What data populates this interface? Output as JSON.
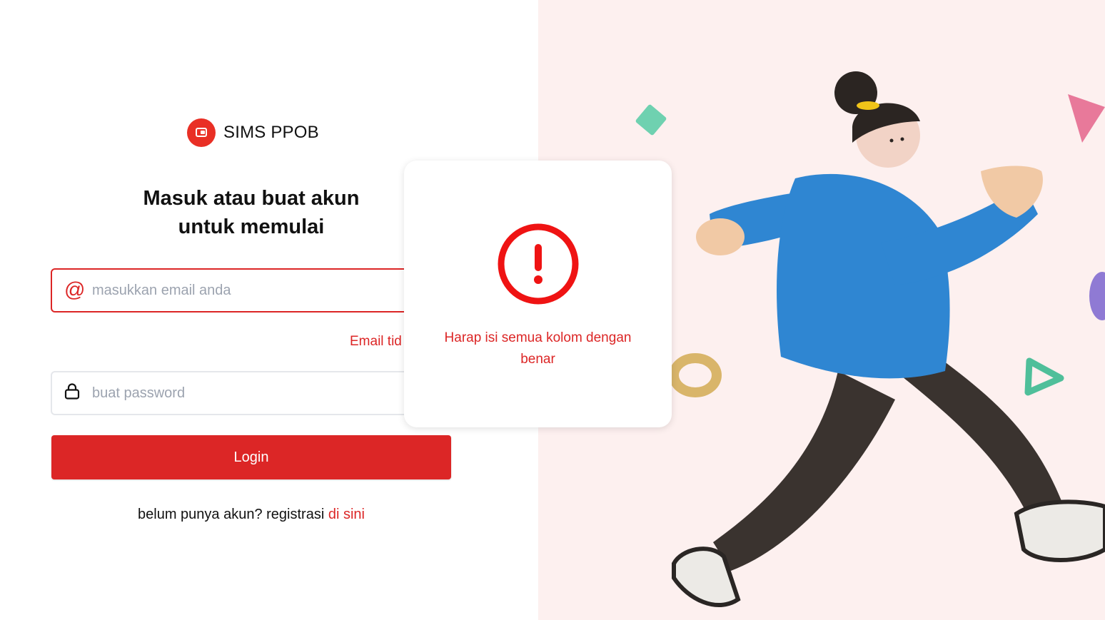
{
  "brand": {
    "name": "SIMS PPOB",
    "logo_icon": "wallet-icon"
  },
  "heading": {
    "line1": "Masuk atau buat akun",
    "line2": "untuk memulai"
  },
  "form": {
    "email": {
      "placeholder": "masukkan email anda",
      "value": "",
      "icon": "at-icon",
      "error": "Email tid"
    },
    "password": {
      "placeholder": "buat password",
      "value": "",
      "icon": "lock-icon"
    },
    "login_label": "Login"
  },
  "register": {
    "prefix": "belum punya akun? registrasi ",
    "link": "di sini"
  },
  "modal": {
    "icon": "alert-circle-icon",
    "message": "Harap isi semua kolom dengan benar"
  },
  "colors": {
    "accent": "#dc2626",
    "illustration_bg": "#fdf0ef"
  }
}
